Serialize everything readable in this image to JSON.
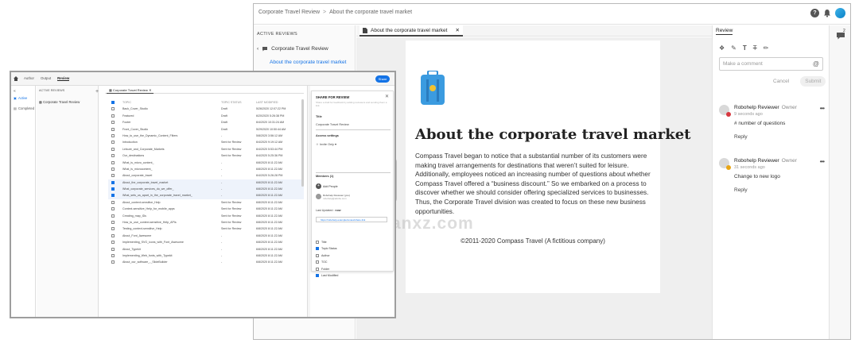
{
  "back_window": {
    "breadcrumb": [
      "Corporate Travel Review",
      "About the corporate travel market"
    ],
    "breadcrumb_sep": ">",
    "top_icons": {
      "help": "?",
      "bell": "bell-icon",
      "avatar": "user-avatar"
    },
    "left_panel": {
      "header": "ACTIVE REVIEWS",
      "back_label": "Corporate Travel Review",
      "selected_topic": "About the corporate travel market"
    },
    "doc_tab": {
      "label": "About the corporate travel market",
      "close": "✕"
    },
    "document": {
      "heading": "About the corporate travel market",
      "paragraph": "Compass Travel began to notice that a substantial number of its customers were making travel arrangements for destinations that weren’t suited for leisure. Additionally, employees noticed an increasing number of questions about whether Compass Travel offered a “business discount.” So we embarked on a process to discover whether we should consider offering specialized services to businesses. Thus, the Corporate Travel division was created to focus on these new business opportunities.",
      "footer": "©2011-2020 Compass Travel (A fictitious company)"
    },
    "review_panel": {
      "title": "Review",
      "comment_placeholder": "Make a comment",
      "cancel": "Cancel",
      "submit": "Submit",
      "comments": [
        {
          "name": "Robohelp Reviewer",
          "role": "Owner",
          "time": "9 seconds ago",
          "text": "# number of questions",
          "reply": "Reply",
          "badge_color": "#d7373f"
        },
        {
          "name": "Robohelp Reviewer",
          "role": "Owner",
          "time": "31 seconds ago",
          "text": "Change to new logo",
          "reply": "Reply",
          "badge_color": "#e8a515"
        }
      ]
    },
    "rail_badge": "2"
  },
  "watermark": {
    "text": "anxz.com"
  },
  "front_window": {
    "top_tabs": [
      "Author",
      "Output",
      "Review"
    ],
    "active_tab": "Review",
    "share_button": "Share",
    "nav": [
      {
        "label": "Active",
        "selected": true
      },
      {
        "label": "Completed",
        "selected": false
      }
    ],
    "left_panel": {
      "header": "ACTIVE REVIEWS",
      "item": "Corporate Travel Review"
    },
    "tab_label": "Corporate Travel Review",
    "table": {
      "headers": [
        "TOPIC",
        "TOPIC STATUS",
        "LAST MODIFIED"
      ],
      "rows": [
        {
          "topic": "Back_Cover_Studio",
          "status": "Draft",
          "modified": "5/26/2020 12:07:22 PM",
          "checked": false
        },
        {
          "topic": "Featured",
          "status": "Draft",
          "modified": "6/20/2020 5:26:38 PM",
          "checked": false
        },
        {
          "topic": "Footer",
          "status": "Draft",
          "modified": "6/4/2020 10:31:24 AM",
          "checked": false
        },
        {
          "topic": "Front_Cover_Studio",
          "status": "Draft",
          "modified": "5/29/2020 10:50:44 AM",
          "checked": false
        },
        {
          "topic": "How_to_use_the_Dynamic_Content_Filters",
          "status": "-",
          "modified": "5/8/2020 3:56:12 AM",
          "checked": false
        },
        {
          "topic": "Introduction",
          "status": "Sent for Review",
          "modified": "6/4/2020 9:19:12 AM",
          "checked": false
        },
        {
          "topic": "Leisure_and_Corporate_Markets",
          "status": "Sent for Review",
          "modified": "6/4/2020 5:53:44 PM",
          "checked": false
        },
        {
          "topic": "Our_destinations",
          "status": "Sent for Review",
          "modified": "6/4/2020 5:25:36 PM",
          "checked": false
        },
        {
          "topic": "What_is_micro_content_",
          "status": "-",
          "modified": "6/8/2020 8:11:22 AM",
          "checked": false
        },
        {
          "topic": "What_is_microcontent_",
          "status": "-",
          "modified": "6/8/2020 8:11:22 AM",
          "checked": false
        },
        {
          "topic": "About_corporate_travel",
          "status": "-",
          "modified": "6/4/2020 5:26:28 PM",
          "checked": false
        },
        {
          "topic": "About_the_corporate_travel_market",
          "status": "-",
          "modified": "6/8/2020 8:11:22 AM",
          "checked": true
        },
        {
          "topic": "What_corporate_services_do_we_offer_",
          "status": "-",
          "modified": "6/8/2020 8:11:22 AM",
          "checked": true
        },
        {
          "topic": "What_sets_us_apart_in_the_corporate_travel_market_",
          "status": "-",
          "modified": "6/8/2020 8:11:22 AM",
          "checked": true
        },
        {
          "topic": "About_context-sensitive_Help",
          "status": "Sent for Review",
          "modified": "6/8/2020 8:11:22 AM",
          "checked": false
        },
        {
          "topic": "Context-sensitive_Help_for_mobile_apps",
          "status": "Sent for Review",
          "modified": "6/8/2020 8:11:22 AM",
          "checked": false
        },
        {
          "topic": "Creating_map_IDs",
          "status": "Sent for Review",
          "modified": "6/8/2020 8:11:22 AM",
          "checked": false
        },
        {
          "topic": "How_to_use_context-sensitive_Help_APIs",
          "status": "Sent for Review",
          "modified": "6/8/2020 8:11:22 AM",
          "checked": false
        },
        {
          "topic": "Testing_context-sensitive_Help",
          "status": "Sent for Review",
          "modified": "6/8/2020 8:11:22 AM",
          "checked": false
        },
        {
          "topic": "About_Font_Awesome",
          "status": "-",
          "modified": "6/8/2020 8:11:22 AM",
          "checked": false
        },
        {
          "topic": "Implementing_SVG_icons_with_Font_Awesome",
          "status": "-",
          "modified": "6/8/2020 8:11:22 AM",
          "checked": false
        },
        {
          "topic": "About_Typekit",
          "status": "-",
          "modified": "6/8/2020 8:11:22 AM",
          "checked": false
        },
        {
          "topic": "Implementing_Web_fonts_with_Typekit",
          "status": "-",
          "modified": "6/8/2020 8:11:22 AM",
          "checked": false
        },
        {
          "topic": "About_our_software_-_SlideBuilder",
          "status": "-",
          "modified": "6/8/2020 8:11:22 AM",
          "checked": false
        }
      ]
    },
    "share_panel": {
      "title": "SHARE FOR REVIEW",
      "close": "✕",
      "description": "Share a draft for feedback by adding reviewers and sending them a link.",
      "title_label": "Title",
      "title_value": "Corporate Travel Review",
      "access_label": "Access settings",
      "access_value": "Invite Only",
      "members_label": "Members (1)",
      "add_people": "Add People",
      "member_name": "Robohelp Reviewer (you)",
      "member_email": "robohelp@adobe.com",
      "last_updated_label": "Last Updated :",
      "last_updated_value": "now",
      "link": "https://robohelp.example/review/share-link",
      "toggles": [
        {
          "label": "Title",
          "checked": false
        },
        {
          "label": "Topic Status",
          "checked": true
        },
        {
          "label": "Author",
          "checked": false
        },
        {
          "label": "TOC",
          "checked": false
        },
        {
          "label": "Folder",
          "checked": false
        },
        {
          "label": "Last Modified",
          "checked": true
        }
      ]
    }
  }
}
